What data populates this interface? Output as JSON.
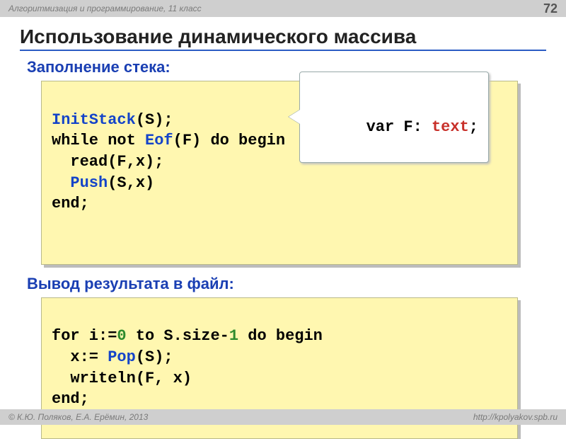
{
  "header": {
    "course": "Алгоритмизация и программирование, 11 класс",
    "page_number": "72"
  },
  "title": "Использование динамического массива",
  "section1": {
    "heading": "Заполнение стека:",
    "callout": {
      "t1": "var F: ",
      "t2": "text",
      "t3": ";"
    },
    "code": {
      "l1a": "InitStack",
      "l1b": "(S);",
      "l2a": "while not ",
      "l2b": "Eof",
      "l2c": "(F) do begin",
      "l3": "  read(F,x);",
      "l4a": "  ",
      "l4b": "Push",
      "l4c": "(S,x)",
      "l5": "end;"
    }
  },
  "section2": {
    "heading": "Вывод результата в файл:",
    "code": {
      "l1a": "for i:=",
      "l1b": "0",
      "l1c": " to S.size-",
      "l1d": "1",
      "l1e": " do begin",
      "l2a": "  x:= ",
      "l2b": "Pop",
      "l2c": "(S);",
      "l3": "  writeln(F, x)",
      "l4": "end;"
    }
  },
  "footer": {
    "authors": "© К.Ю. Поляков, Е.А. Ерёмин, 2013",
    "url": "http://kpolyakov.spb.ru"
  }
}
